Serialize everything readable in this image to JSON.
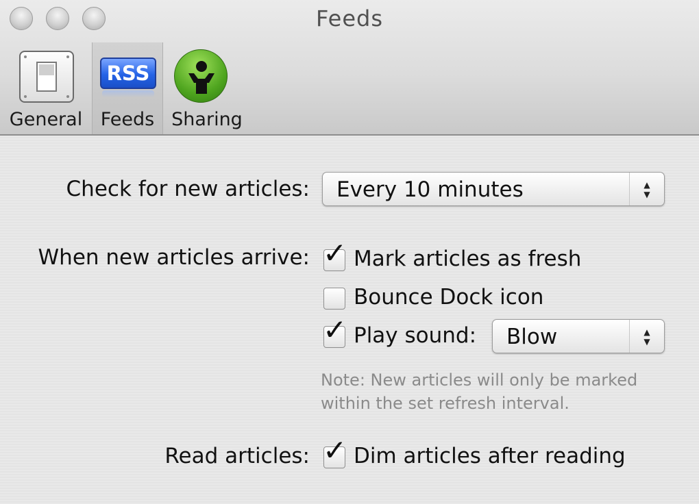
{
  "window": {
    "title": "Feeds"
  },
  "toolbar": {
    "items": [
      {
        "label": "General",
        "icon": "switch-icon"
      },
      {
        "label": "Feeds",
        "icon": "rss-icon",
        "icon_text": "RSS",
        "selected": true
      },
      {
        "label": "Sharing",
        "icon": "person-sharing-icon"
      }
    ]
  },
  "settings": {
    "check_label": "Check for new articles:",
    "check_value": "Every 10 minutes",
    "arrive_label": "When new articles arrive:",
    "mark_fresh": {
      "label": "Mark articles as fresh",
      "checked": true
    },
    "bounce_dock": {
      "label": "Bounce Dock icon",
      "checked": false
    },
    "play_sound": {
      "label": "Play sound:",
      "checked": true,
      "sound_value": "Blow"
    },
    "note_line1": "Note: New articles will only be marked",
    "note_line2": "within the set refresh interval.",
    "read_label": "Read articles:",
    "dim_articles": {
      "label": "Dim articles after reading",
      "checked": true
    }
  },
  "colors": {
    "rss_blue": "#2563e6",
    "sharing_green": "#4fa51f",
    "note_gray": "#8a8a8a"
  }
}
